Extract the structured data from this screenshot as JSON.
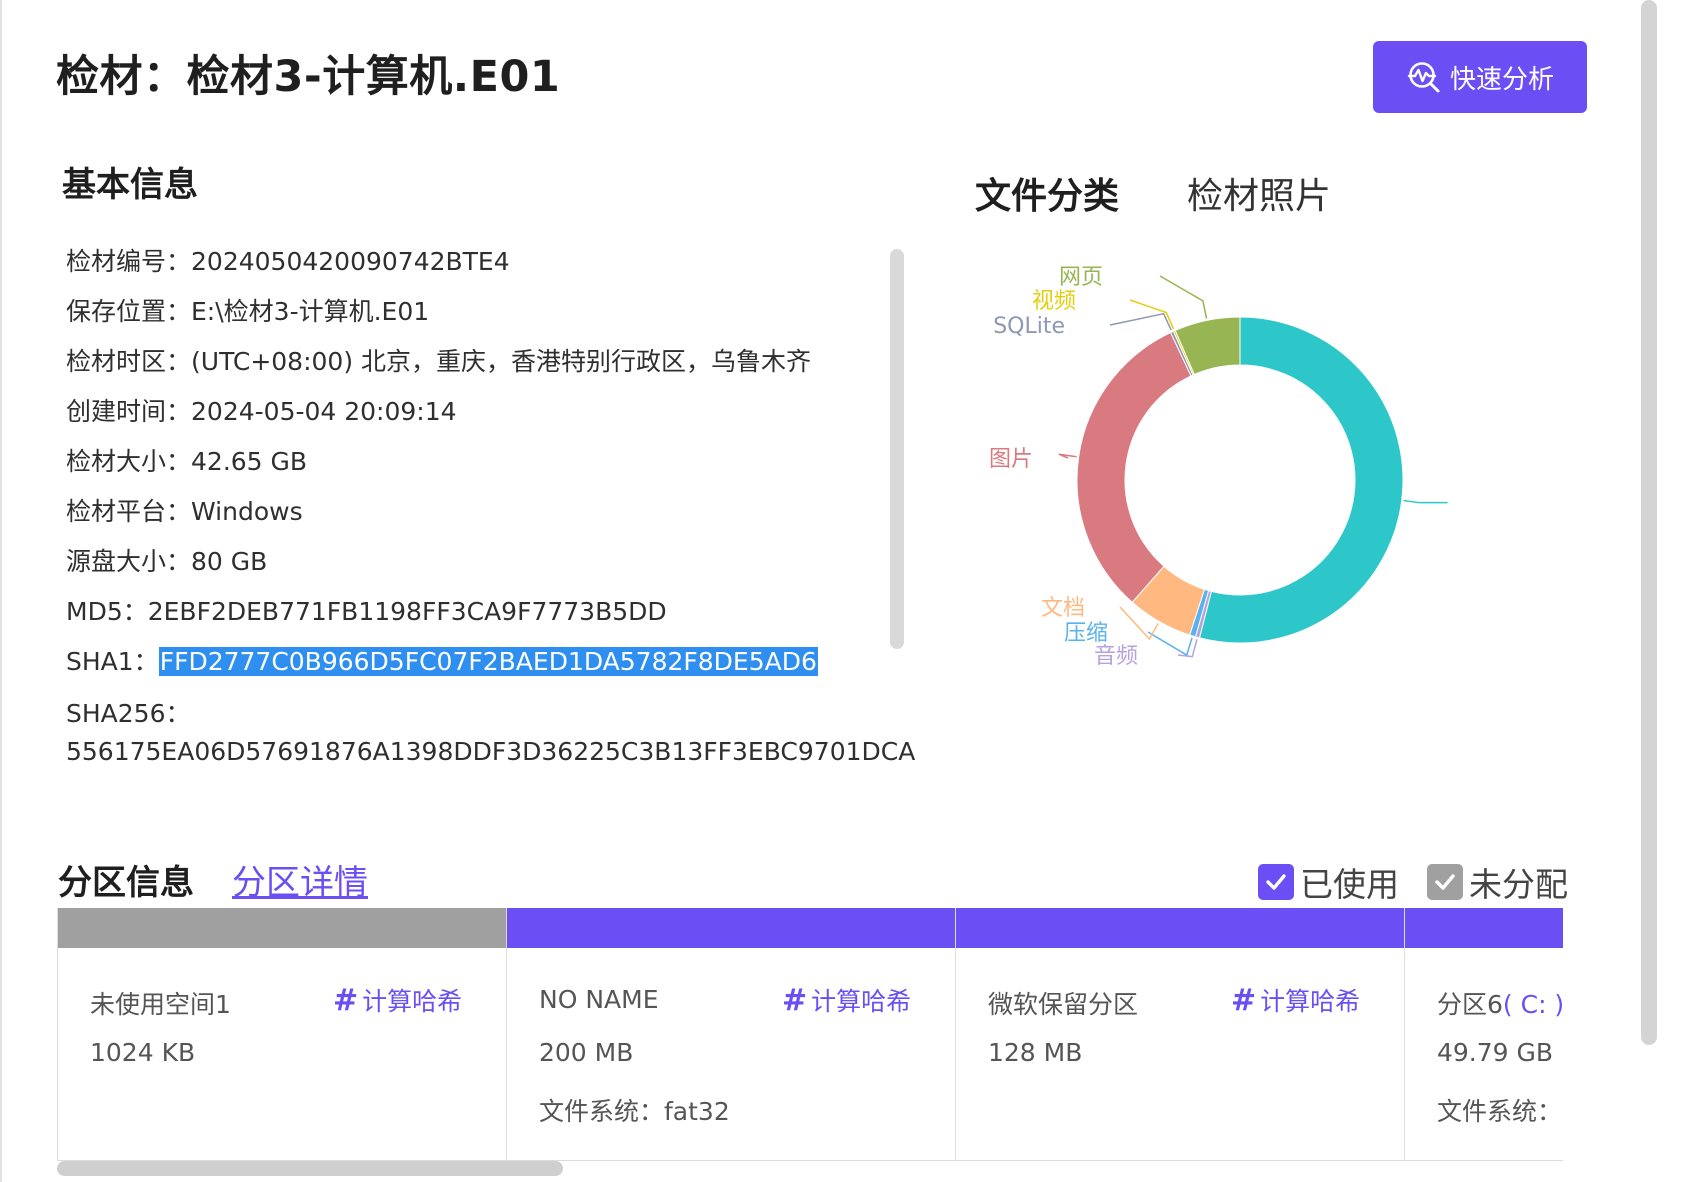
{
  "header": {
    "title": "检材：检材3-计算机.E01",
    "quick_analysis_label": "快速分析"
  },
  "basic_info": {
    "title": "基本信息",
    "rows": [
      {
        "label": "检材编号：",
        "value": "2024050420090742BTE4"
      },
      {
        "label": "保存位置：",
        "value": "E:\\检材3-计算机.E01"
      },
      {
        "label": "检材时区：",
        "value": "(UTC+08:00) 北京，重庆，香港特别行政区，乌鲁木齐"
      },
      {
        "label": "创建时间：",
        "value": "2024-05-04 20:09:14"
      },
      {
        "label": "检材大小：",
        "value": "42.65 GB"
      },
      {
        "label": "检材平台：",
        "value": "Windows"
      },
      {
        "label": "源盘大小：",
        "value": "80 GB"
      },
      {
        "label": "MD5：",
        "value": "2EBF2DEB771FB1198FF3CA9F7773B5DD"
      },
      {
        "label": "SHA1：",
        "value": "FFD2777C0B966D5FC07F2BAED1DA5782F8DE5AD6"
      },
      {
        "label": "SHA256：",
        "value": "556175EA06D57691876A1398DDF3D36225C3B13FF3EBC9701DCA"
      }
    ]
  },
  "file_tabs": {
    "active": "文件分类",
    "other": "检材照片"
  },
  "chart_data": {
    "type": "pie",
    "title": "",
    "slices": [
      {
        "name": "",
        "value": 54.0,
        "color": "#2ec7c9"
      },
      {
        "name": "音频",
        "value": 0.4,
        "color": "#b6a2de"
      },
      {
        "name": "压缩",
        "value": 0.6,
        "color": "#5ab1ef"
      },
      {
        "name": "文档",
        "value": 6.5,
        "color": "#ffb980"
      },
      {
        "name": "图片",
        "value": 31.5,
        "color": "#d87a80"
      },
      {
        "name": "SQLite",
        "value": 0.3,
        "color": "#8d98b3"
      },
      {
        "name": "视频",
        "value": 0.2,
        "color": "#e5cf0d"
      },
      {
        "name": "网页",
        "value": 6.5,
        "color": "#97b552"
      }
    ]
  },
  "partitions": {
    "title": "分区信息",
    "detail_link": "分区详情",
    "legend": [
      {
        "label": "已使用",
        "color": "#6b4ff5"
      },
      {
        "label": "未分配",
        "color": "#a0a0a0"
      }
    ],
    "hash_label": "计算哈希",
    "items": [
      {
        "name": "未使用空间1",
        "size": "1024 KB",
        "fs": "",
        "bar_color": "#a0a0a0",
        "hash": true
      },
      {
        "name": "NO NAME",
        "size": "200 MB",
        "fs": "文件系统：fat32",
        "bar_color": "#6b4ff5",
        "hash": true
      },
      {
        "name": "微软保留分区",
        "size": "128 MB",
        "fs": "",
        "bar_color": "#6b4ff5",
        "hash": true
      },
      {
        "name": "分区6",
        "volume": "( C: )",
        "size": "49.79 GB",
        "fs": "文件系统：",
        "bar_color": "#6b4ff5",
        "hash": false
      }
    ]
  }
}
